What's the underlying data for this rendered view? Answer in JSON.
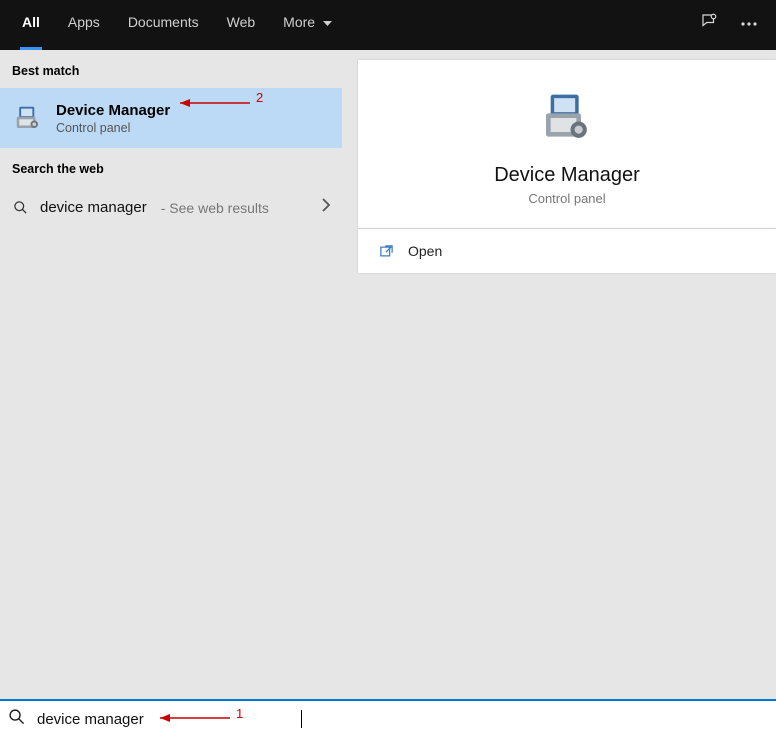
{
  "tabs": {
    "all": "All",
    "apps": "Apps",
    "documents": "Documents",
    "web": "Web",
    "more": "More"
  },
  "sections": {
    "best_match": "Best match",
    "search_web": "Search the web"
  },
  "best_match": {
    "title": "Device Manager",
    "subtitle": "Control panel"
  },
  "web_result": {
    "query": "device manager",
    "suffix": " - See web results"
  },
  "detail": {
    "title": "Device Manager",
    "subtitle": "Control panel"
  },
  "actions": {
    "open": "Open"
  },
  "search": {
    "value": "device manager"
  },
  "annotations": {
    "step1": "1",
    "step2": "2"
  }
}
